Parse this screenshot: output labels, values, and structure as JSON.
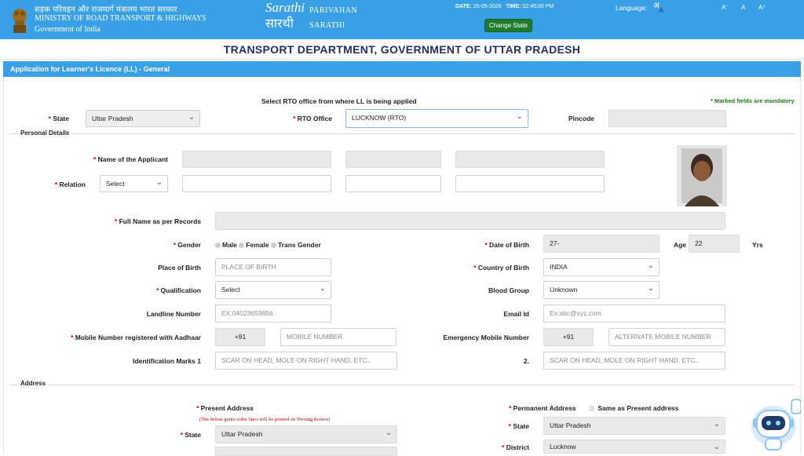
{
  "header": {
    "ministry_hindi": "सड़क परिवहन और राजमार्ग मंत्रालय भारत सरकार",
    "ministry_english": "MINISTRY OF ROAD TRANSPORT & HIGHWAYS",
    "government": "Government of India",
    "logo_script": "Sarathi",
    "logo_hindi": "सारथी",
    "brand_line1": "PARIVAHAN",
    "brand_line2": "SARATHI",
    "date_label": "DATE:",
    "date_value": "25-05-2026",
    "time_label": "TIME:",
    "time_value": "02:45:00 PM",
    "change_state": "Change State",
    "language_label": "Language:",
    "language_glyph": "अ",
    "language_glyph2": "A",
    "font_small": "A⁻",
    "font_normal": "A",
    "font_large": "A⁺"
  },
  "page_title": "TRANSPORT DEPARTMENT, GOVERNMENT OF UTTAR PRADESH",
  "app_title": "Application for Learner's Licence (LL) - General",
  "rto_section": {
    "instruction": "Select RTO office from where LL is being applied",
    "mandatory_note": "* Marked fields are mandatory",
    "state_label": "State",
    "state_value": "Uttar Pradesh",
    "rto_label": "RTO Office",
    "rto_value": "LUCKNOW (RTO)",
    "pincode_label": "Pincode"
  },
  "personal": {
    "legend": "Personal Details",
    "name_label": "Name of the Applicant",
    "relation_label": "Relation",
    "relation_value": "Select",
    "fullname_label": "Full Name as per Records",
    "gender_label": "Gender",
    "gender_options": [
      "Male",
      "Female",
      "Trans Gender"
    ],
    "dob_label": "Date of Birth",
    "dob_value": "27-",
    "age_label": "Age",
    "age_value": "22",
    "age_unit": "Yrs",
    "pob_label": "Place of Birth",
    "pob_placeholder": "PLACE OF BIRTH",
    "country_label": "Country of Birth",
    "country_value": "INDIA",
    "qual_label": "Qualification",
    "qual_value": "Select",
    "blood_label": "Blood Group",
    "blood_value": "Unknown",
    "landline_label": "Landline Number",
    "landline_placeholder": "EX:04023659856",
    "email_label": "Email Id",
    "email_placeholder": "Ex:abc@xyz.com",
    "mobile_label": "Mobile Number registered with Aadhaar",
    "mobile_code": "+91",
    "mobile_placeholder": "MOBILE NUMBER",
    "emergency_label": "Emergency Mobile Number",
    "emergency_code": "+91",
    "emergency_placeholder": "ALTERNATE MOBILE NUMBER",
    "idmark1_label": "Identification Marks 1",
    "idmark1_placeholder": "SCAR ON HEAD, MOLE ON RIGHT HAND, ETC..",
    "idmark2_label": "2.",
    "idmark2_placeholder": "SCAR ON HEAD, MOLE ON RIGHT HAND, ETC.."
  },
  "address": {
    "legend": "Address",
    "present_label": "Present Address",
    "present_note": "(The below green color lines will be printed on Driving licence)",
    "present_state_label": "State",
    "present_state_value": "Uttar Pradesh",
    "permanent_label": "Permanent Address",
    "same_label": "Same as Present address",
    "perm_state_label": "State",
    "perm_state_value": "Uttar Pradesh",
    "perm_district_label": "District",
    "perm_district_value": "Lucknow"
  },
  "colors": {
    "header_blue": "#3aa0e6",
    "title_navy": "#1f2f6b",
    "mandatory_green": "#1b7a1b",
    "required_red": "#d00000"
  }
}
